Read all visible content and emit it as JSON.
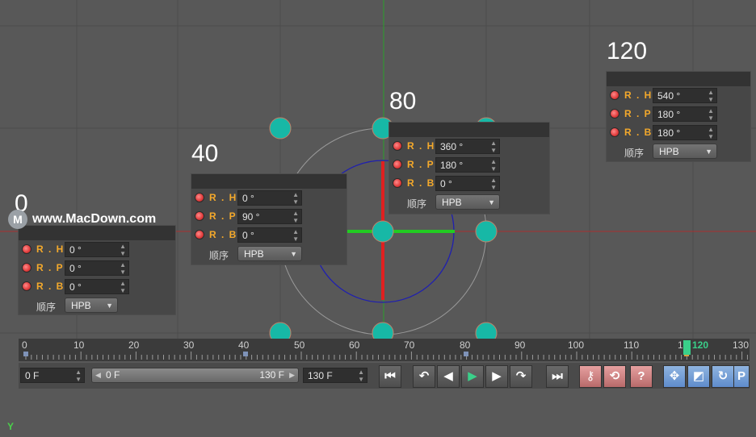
{
  "keyframes": [
    {
      "label": "0",
      "rows": [
        {
          "name": "R . H",
          "value": "0 °"
        },
        {
          "name": "R . P",
          "value": "0 °"
        },
        {
          "name": "R . B",
          "value": "0 °"
        }
      ],
      "order_label": "顺序",
      "order_value": "HPB"
    },
    {
      "label": "40",
      "rows": [
        {
          "name": "R . H",
          "value": "0 °"
        },
        {
          "name": "R . P",
          "value": "90 °"
        },
        {
          "name": "R . B",
          "value": "0 °"
        }
      ],
      "order_label": "顺序",
      "order_value": "HPB"
    },
    {
      "label": "80",
      "rows": [
        {
          "name": "R . H",
          "value": "360 °"
        },
        {
          "name": "R . P",
          "value": "180 °"
        },
        {
          "name": "R . B",
          "value": "0 °"
        }
      ],
      "order_label": "顺序",
      "order_value": "HPB"
    },
    {
      "label": "120",
      "rows": [
        {
          "name": "R . H",
          "value": "540 °"
        },
        {
          "name": "R . P",
          "value": "180 °"
        },
        {
          "name": "R . B",
          "value": "180 °"
        }
      ],
      "order_label": "顺序",
      "order_value": "HPB"
    }
  ],
  "watermark": {
    "logo": "M",
    "text": "www.MacDown.com"
  },
  "timeline": {
    "ticks": [
      "0",
      "10",
      "20",
      "30",
      "40",
      "50",
      "60",
      "70",
      "80",
      "90",
      "100",
      "110",
      "1",
      "120",
      "130"
    ],
    "current_frame": "120",
    "key_marker_icon": "keyframe-marker-icon"
  },
  "transport": {
    "start_field": "0 F",
    "range_start": "0 F",
    "range_end": "130 F",
    "end_field": "130 F",
    "buttons": [
      {
        "name": "go-to-start-button",
        "icon": "skip-start-icon",
        "glyph": "⏮"
      },
      {
        "name": "previous-key-button",
        "icon": "previous-key-icon",
        "glyph": "↶"
      },
      {
        "name": "previous-frame-button",
        "icon": "previous-frame-icon",
        "glyph": "◀"
      },
      {
        "name": "play-button",
        "icon": "play-icon",
        "glyph": "▶"
      },
      {
        "name": "next-frame-button",
        "icon": "next-frame-icon",
        "glyph": "▶"
      },
      {
        "name": "next-key-button",
        "icon": "next-key-icon",
        "glyph": "↷"
      },
      {
        "name": "go-to-end-button",
        "icon": "skip-end-icon",
        "glyph": "⏭"
      },
      {
        "name": "record-keys-button",
        "icon": "key-icon",
        "glyph": "⚷"
      },
      {
        "name": "autokey-button",
        "icon": "autokey-icon",
        "glyph": "⟲"
      },
      {
        "name": "key-help-button",
        "icon": "question-icon",
        "glyph": "?"
      },
      {
        "name": "move-tool-button",
        "icon": "move-icon",
        "glyph": "✥"
      },
      {
        "name": "scale-tool-button",
        "icon": "scale-icon",
        "glyph": "◩"
      },
      {
        "name": "rotate-tool-button",
        "icon": "rotate-icon",
        "glyph": "↻"
      },
      {
        "name": "parameter-button",
        "icon": "parameter-icon",
        "glyph": "P"
      }
    ]
  },
  "axis_label": "Y",
  "colors": {
    "background": "#585858",
    "axis_green": "#22cc22",
    "axis_red": "#e02020",
    "orbit_blue": "#1f1fb0",
    "node_teal": "#17b8a6",
    "label_orange": "#f4a92b"
  }
}
